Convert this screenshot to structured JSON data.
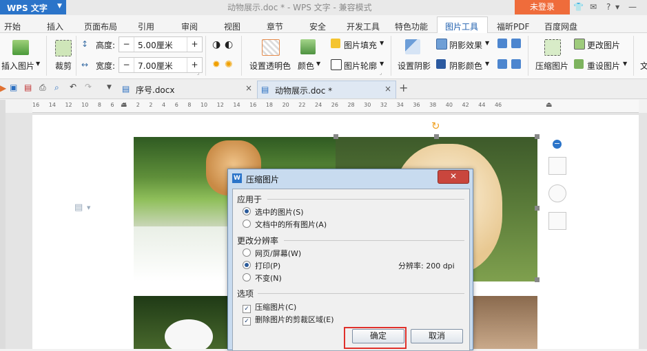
{
  "app": {
    "menu_label": "WPS 文字",
    "title": "动物展示.doc * - WPS 文字 - 兼容模式",
    "login": "未登录"
  },
  "menu_tabs": [
    "开始",
    "插入",
    "页面布局",
    "引用",
    "审阅",
    "视图",
    "章节",
    "安全",
    "开发工具",
    "特色功能",
    "图片工具",
    "福昕PDF",
    "百度网盘"
  ],
  "active_tab": "图片工具",
  "ribbon": {
    "insert_picture": "插入图片",
    "crop": "裁剪",
    "height_label": "高度:",
    "height_value": "5.00厘米",
    "width_label": "宽度:",
    "width_value": "7.00厘米",
    "set_transparent": "设置透明色",
    "color": "颜色",
    "picture_fill": "图片填充",
    "picture_outline": "图片轮廓",
    "set_shadow": "设置阴影",
    "shadow_effect": "阴影效果",
    "shadow_color": "阴影颜色",
    "compress": "压缩图片",
    "change_picture": "更改图片",
    "reset_picture": "重设图片",
    "text_wrap": "文"
  },
  "doc_tabs": [
    {
      "label": "序号.docx",
      "active": false
    },
    {
      "label": "动物展示.doc *",
      "active": true
    }
  ],
  "ruler_text": "16 14 12 10 8 6 4 2 2 4 6 8 10 12 14 16 18 20 22 24 26 28 30 32 34 36 38 40 42 44 46",
  "dialog": {
    "title": "压缩图片",
    "apply_to": "应用于",
    "apply_options": [
      {
        "label": "选中的图片(S)",
        "checked": true
      },
      {
        "label": "文档中的所有图片(A)",
        "checked": false
      }
    ],
    "resolution_section": "更改分辨率",
    "resolution_options": [
      {
        "label": "网页/屏幕(W)",
        "checked": false
      },
      {
        "label": "打印(P)",
        "checked": true
      },
      {
        "label": "不变(N)",
        "checked": false
      }
    ],
    "resolution_text": "分辨率: 200 dpi",
    "options_section": "选项",
    "checkbox_options": [
      {
        "label": "压缩图片(C)",
        "checked": true
      },
      {
        "label": "删除图片的剪裁区域(E)",
        "checked": true
      }
    ],
    "ok": "确定",
    "cancel": "取消"
  },
  "colors": {
    "accent": "#2b74c9",
    "login": "#ef6c3b",
    "highlight": "#e0302a"
  }
}
